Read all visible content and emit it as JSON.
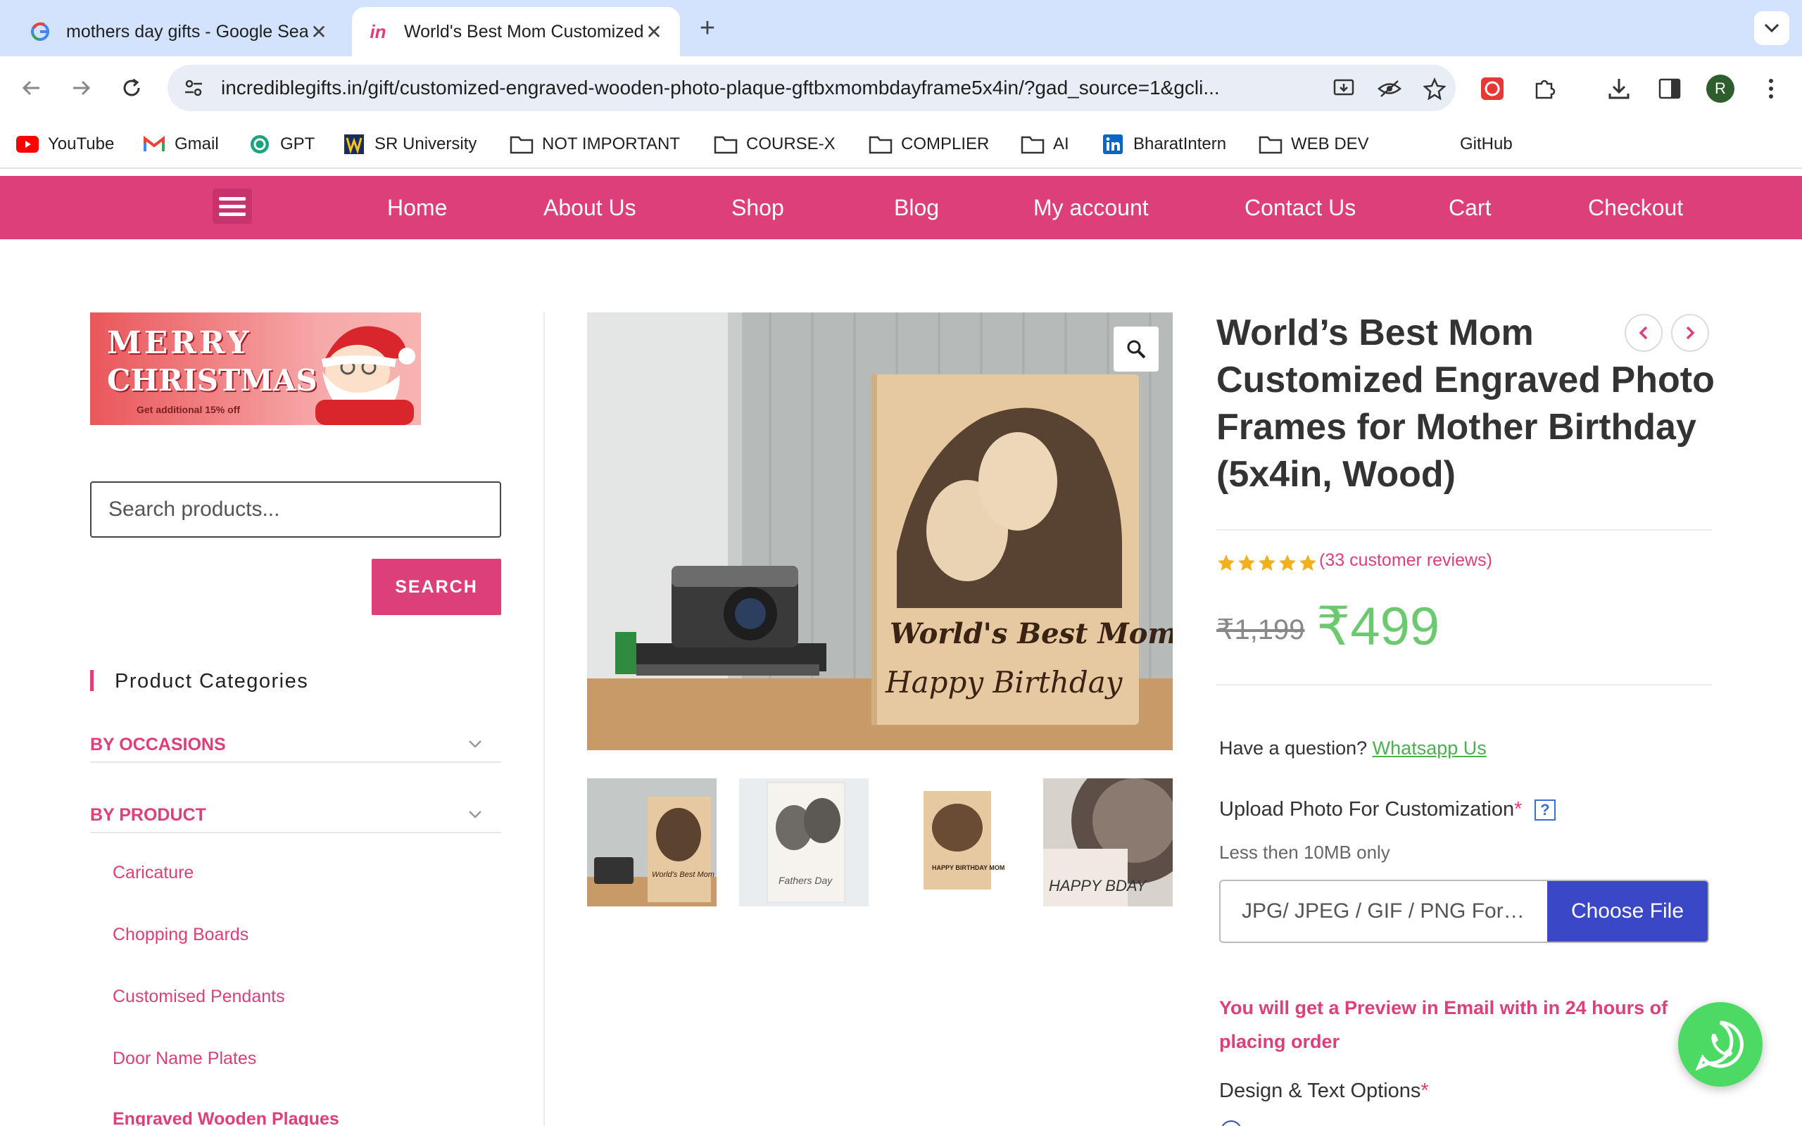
{
  "browser": {
    "tabs": [
      {
        "title": "mothers day gifts - Google Search",
        "favicon": "google-g-icon"
      },
      {
        "title": "World's Best Mom Customized Engraved Photo Frames",
        "favicon": "incrediblegifts-icon"
      }
    ],
    "url_domain": "incrediblegifts.in",
    "url_path": "/gift/customized-engraved-wooden-photo-plaque-gftbxmombdayframe5x4in/?gad_source=1&gcli...",
    "avatar_letter": "R",
    "bookmarks": [
      {
        "label": "YouTube",
        "icon": "youtube-icon"
      },
      {
        "label": "Gmail",
        "icon": "gmail-icon"
      },
      {
        "label": "GPT",
        "icon": "openai-icon"
      },
      {
        "label": "SR University",
        "icon": "sr-university-icon"
      },
      {
        "label": "NOT IMPORTANT",
        "icon": "folder-icon"
      },
      {
        "label": "COURSE-X",
        "icon": "folder-icon"
      },
      {
        "label": "COMPLIER",
        "icon": "folder-icon"
      },
      {
        "label": "AI",
        "icon": "folder-icon"
      },
      {
        "label": "BharatIntern",
        "icon": "linkedin-icon"
      },
      {
        "label": "WEB DEV",
        "icon": "folder-icon"
      },
      {
        "label": "GitHub",
        "icon": "github-icon"
      }
    ]
  },
  "site": {
    "brand_color": "#dd3f7b",
    "nav": [
      "Home",
      "About Us",
      "Shop",
      "Blog",
      "My account",
      "Contact Us",
      "Cart",
      "Checkout"
    ]
  },
  "sidebar": {
    "banner": {
      "line1": "MERRY",
      "line2": "CHRISTMAS",
      "offer": "Get additional 15% off"
    },
    "search_placeholder": "Search products...",
    "search_button": "SEARCH",
    "categories_title": "Product Categories",
    "category_groups": [
      "BY OCCASIONS",
      "BY PRODUCT"
    ],
    "product_items": [
      "Caricature",
      "Chopping Boards",
      "Customised Pendants",
      "Door Name Plates",
      "Engraved Wooden Plaques"
    ]
  },
  "product": {
    "title": "World’s Best Mom Customized Engraved Photo Frames for Mother Birthday (5x4in, Wood)",
    "image_text_line1": "World's Best Mom",
    "image_text_line2": "Happy Birthday",
    "rating": 5,
    "reviews": "(33 customer reviews)",
    "old_price": "₹1,199",
    "new_price": "₹499",
    "question": "Have a question?",
    "whatsapp_link": "Whatsapp Us",
    "upload_label": "Upload Photo For Customization",
    "required_mark": "*",
    "help_mark": "?",
    "upload_hint": "Less then 10MB only",
    "file_placeholder": "JPG/ JPEG / GIF / PNG Format Only",
    "file_button": "Choose File",
    "preview_note": "You will get a Preview in Email with in 24 hours of placing order",
    "design_label": "Design & Text Options"
  },
  "thumbs": [
    {
      "text": "World's Best Mom"
    },
    {
      "text": "Fathers Day"
    },
    {
      "text": "HAPPY BIRTHDAY MOM"
    },
    {
      "text": "HAPPY BDAY"
    }
  ]
}
